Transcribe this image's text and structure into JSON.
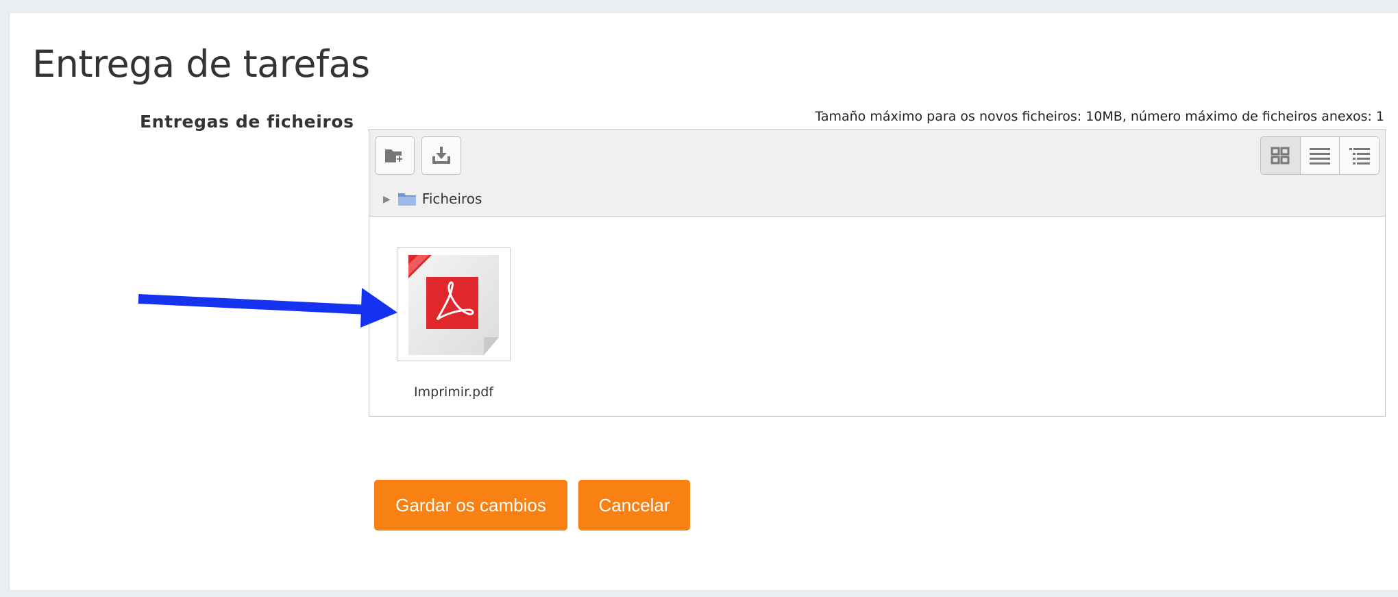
{
  "page": {
    "title": "Entrega de tarefas"
  },
  "submission": {
    "field_label": "Entregas de ficheiros",
    "limits_text": "Tamaño máximo para os novos ficheiros: 10MB, número máximo de ficheiros anexos: 1"
  },
  "filemanager": {
    "toolbar": {
      "buttons": [
        {
          "icon": "add-folder-icon"
        },
        {
          "icon": "download-icon"
        }
      ],
      "views": [
        {
          "icon": "grid-view-icon",
          "selected": true
        },
        {
          "icon": "list-view-icon",
          "selected": false
        },
        {
          "icon": "tree-view-icon",
          "selected": false
        }
      ]
    },
    "path": {
      "label": "Ficheiros",
      "icon": "folder-icon"
    },
    "files": [
      {
        "name": "Imprimir.pdf",
        "icon": "pdf-file-icon"
      }
    ]
  },
  "actions": {
    "save_label": "Gardar os cambios",
    "cancel_label": "Cancelar"
  },
  "colors": {
    "accent": "#f98012",
    "annotation_arrow": "#1432f0",
    "pdf_red": "#e0282c"
  }
}
